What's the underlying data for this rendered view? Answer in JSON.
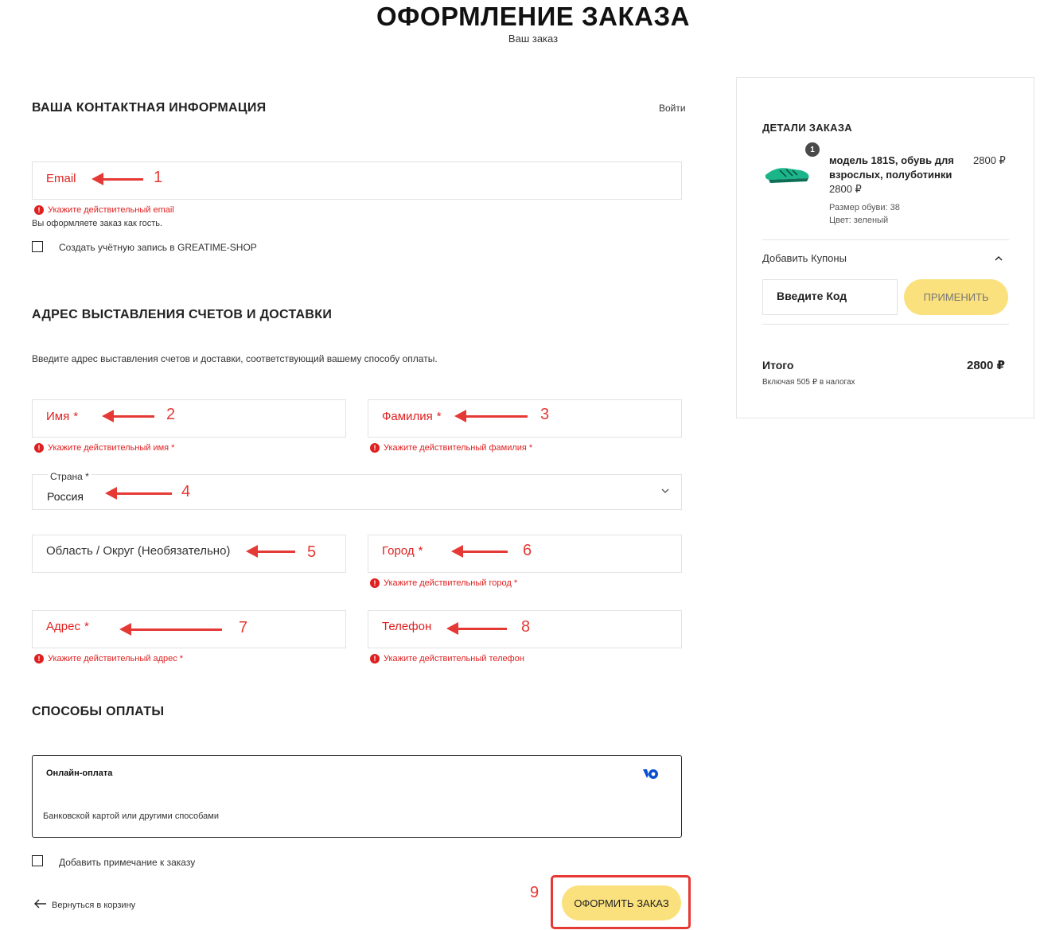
{
  "header": {
    "title": "ОФОРМЛЕНИЕ ЗАКАЗА",
    "subtitle": "Ваш заказ"
  },
  "contact": {
    "heading": "ВАША КОНТАКТНАЯ ИНФОРМАЦИЯ",
    "login_link": "Войти",
    "email_label": "Email",
    "email_error": "Укажите действительный email",
    "guest_note": "Вы оформляете заказ как гость.",
    "create_account_label": "Создать учётную запись в GREATIME-SHOP"
  },
  "address": {
    "heading": "АДРЕС ВЫСТАВЛЕНИЯ СЧЕТОВ И ДОСТАВКИ",
    "description": "Введите адрес выставления счетов и доставки, соответствующий вашему способу оплаты.",
    "first_name_label": "Имя",
    "first_name_error": "Укажите действительный имя *",
    "last_name_label": "Фамилия",
    "last_name_error": "Укажите действительный фамилия *",
    "country_label": "Страна *",
    "country_value": "Россия",
    "region_label": "Область / Округ (Необязательно)",
    "city_label": "Город",
    "city_error": "Укажите действительный город *",
    "street_label": "Адрес",
    "street_error": "Укажите действительный адрес *",
    "phone_label": "Телефон",
    "phone_error": "Укажите действительный телефон",
    "required_mark": "*",
    "error_glyph": "!"
  },
  "payment": {
    "heading": "СПОСОБЫ ОПЛАТЫ",
    "method_title": "Онлайн-оплата",
    "method_desc": "Банковской картой или другими способами",
    "provider_icon": "yookassa-logo-icon",
    "add_note_label": "Добавить примечание к заказу"
  },
  "footer": {
    "back_label": "Вернуться в корзину",
    "submit_label": "ОФОРМИТЬ ЗАКАЗ"
  },
  "annotations": {
    "numbers": [
      "1",
      "2",
      "3",
      "4",
      "5",
      "6",
      "7",
      "8",
      "9"
    ],
    "color": "#e53935"
  },
  "order": {
    "heading": "ДЕТАЛИ ЗАКАЗА",
    "item": {
      "qty": "1",
      "name": "модель 181S, обувь для взрослых, полуботинки",
      "unit_price": "2800 ₽",
      "line_total": "2800 ₽",
      "size": "Размер обуви: 38",
      "color": "Цвет: зеленый"
    },
    "coupons_label": "Добавить Купоны",
    "coupon_placeholder": "Введите Код",
    "apply_label": "ПРИМЕНИТЬ",
    "total_label": "Итого",
    "total_value": "2800 ₽",
    "tax_note": "Включая 505 ₽ в налогах"
  },
  "colors": {
    "accent_yellow": "#fae17d",
    "error_red": "#e02020",
    "annotation_red": "#e53935"
  }
}
